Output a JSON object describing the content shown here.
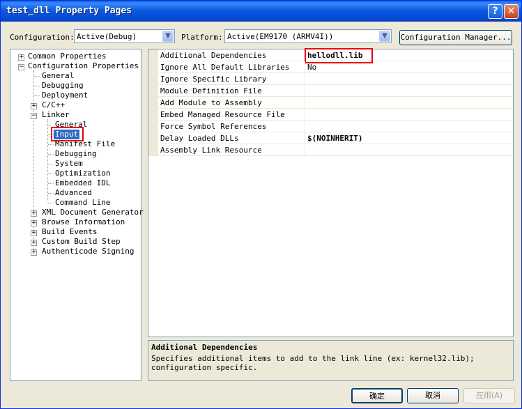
{
  "window": {
    "title": "test_dll Property Pages",
    "help_glyph": "?",
    "close_glyph": "✕"
  },
  "toolbar": {
    "configuration_label": "Configuration:",
    "configuration_value": "Active(Debug)",
    "platform_label": "Platform:",
    "platform_value": "Active(EM9170 (ARMV4I))",
    "config_manager_label": "Configuration Manager..."
  },
  "tree": {
    "common_properties": "Common Properties",
    "configuration_properties": "Configuration Properties",
    "general": "General",
    "debugging": "Debugging",
    "deployment": "Deployment",
    "c_cpp": "C/C++",
    "linker": "Linker",
    "linker_children": [
      "General",
      "Input",
      "Manifest File",
      "Debugging",
      "System",
      "Optimization",
      "Embedded IDL",
      "Advanced",
      "Command Line"
    ],
    "after_linker": [
      "XML Document Generator",
      "Browse Information",
      "Build Events",
      "Custom Build Step",
      "Authenticode Signing"
    ],
    "selected": "Input"
  },
  "properties": [
    {
      "name": "Additional Dependencies",
      "value": "hellodll.lib",
      "bold": true
    },
    {
      "name": "Ignore All Default Libraries",
      "value": "No",
      "bold": false
    },
    {
      "name": "Ignore Specific Library",
      "value": "",
      "bold": false
    },
    {
      "name": "Module Definition File",
      "value": "",
      "bold": false
    },
    {
      "name": "Add Module to Assembly",
      "value": "",
      "bold": false
    },
    {
      "name": "Embed Managed Resource File",
      "value": "",
      "bold": false
    },
    {
      "name": "Force Symbol References",
      "value": "",
      "bold": false
    },
    {
      "name": "Delay Loaded DLLs",
      "value": "$(NOINHERIT)",
      "bold": true
    },
    {
      "name": "Assembly Link Resource",
      "value": "",
      "bold": false
    }
  ],
  "description": {
    "title": "Additional Dependencies",
    "text": "Specifies additional items to add to the link line (ex: kernel32.lib); configuration specific."
  },
  "buttons": {
    "ok": "确定",
    "cancel": "取消",
    "apply": "应用(A)"
  },
  "colors": {
    "titlebar": "#0a5fe8",
    "selection": "#316ac5",
    "highlight_box": "#e00000",
    "dialog_bg": "#ece9d8"
  },
  "icons": {
    "collapsed": "plus-box-icon",
    "expanded": "minus-box-icon",
    "dropdown": "chevron-down-icon"
  }
}
